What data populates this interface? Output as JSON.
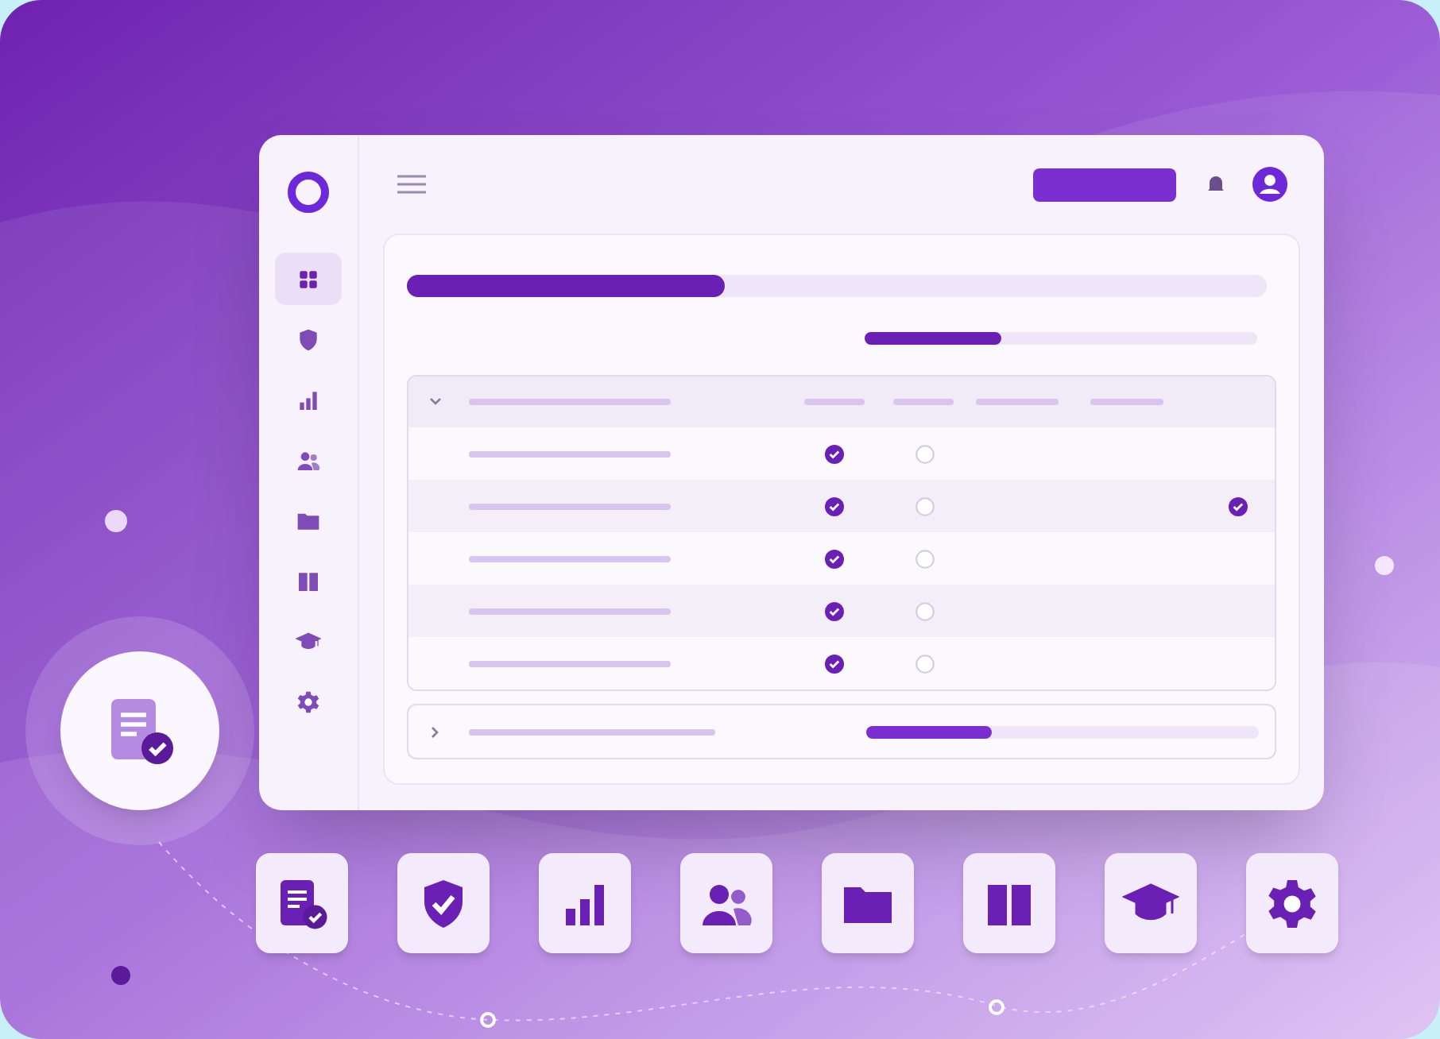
{
  "sidebar": {
    "items": [
      {
        "kind": "grid",
        "selected": true
      },
      {
        "kind": "shield",
        "selected": false
      },
      {
        "kind": "chart",
        "selected": false
      },
      {
        "kind": "users",
        "selected": false
      },
      {
        "kind": "folder",
        "selected": false
      },
      {
        "kind": "book",
        "selected": false
      },
      {
        "kind": "cap",
        "selected": false
      },
      {
        "kind": "gear",
        "selected": false
      }
    ]
  },
  "overall_progress": {
    "level": 0.37
  },
  "summary_progress": {
    "level": 0.35
  },
  "group": {
    "expanded": true,
    "rows": [
      {
        "cells": [
          {
            "checked": true
          },
          {
            "checked": false
          },
          {
            "checked": false
          }
        ]
      },
      {
        "cells": [
          {
            "checked": true
          },
          {
            "checked": false
          },
          {
            "checked": true
          }
        ]
      },
      {
        "cells": [
          {
            "checked": true
          },
          {
            "checked": false
          },
          {
            "checked": false
          }
        ]
      },
      {
        "cells": [
          {
            "checked": true
          },
          {
            "checked": false
          },
          {
            "checked": false
          }
        ]
      },
      {
        "cells": [
          {
            "checked": true
          },
          {
            "checked": false
          },
          {
            "checked": false
          }
        ]
      }
    ]
  },
  "collapsed_group": {
    "expanded": false,
    "level": 0.32
  },
  "tiles": [
    {
      "kind": "document"
    },
    {
      "kind": "shield"
    },
    {
      "kind": "chart"
    },
    {
      "kind": "users"
    },
    {
      "kind": "folder"
    },
    {
      "kind": "book"
    },
    {
      "kind": "cap"
    },
    {
      "kind": "gear"
    }
  ]
}
